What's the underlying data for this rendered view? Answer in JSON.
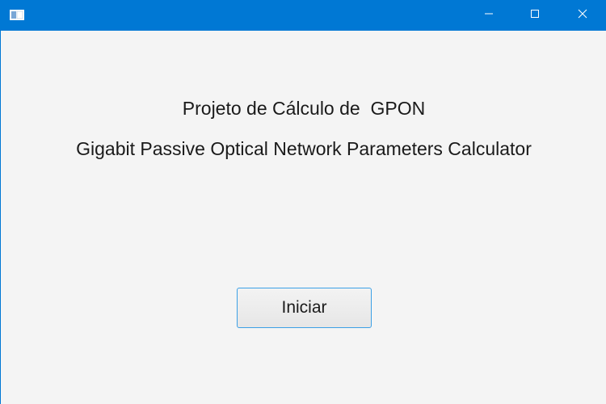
{
  "window": {
    "controls": {
      "minimize": "minimize-icon",
      "maximize": "maximize-icon",
      "close": "close-icon"
    },
    "accent_color": "#0078d4"
  },
  "main": {
    "title": "Projeto de Cálculo de  GPON",
    "subtitle": "Gigabit Passive Optical Network Parameters Calculator",
    "start_button_label": "Iniciar"
  }
}
